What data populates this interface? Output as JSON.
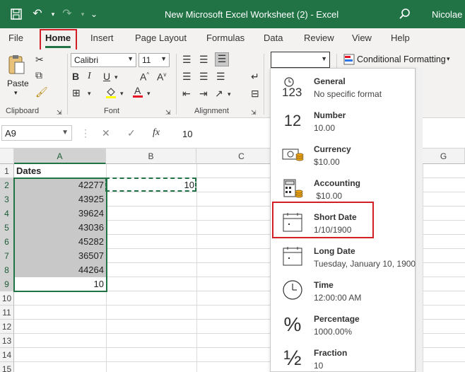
{
  "titlebar": {
    "title": "New Microsoft Excel Worksheet (2)  -  Excel",
    "user": "Nicolae",
    "color": "#217346"
  },
  "tabs": [
    "File",
    "Home",
    "Insert",
    "Page Layout",
    "Formulas",
    "Data",
    "Review",
    "View",
    "Help"
  ],
  "active_tab": "Home",
  "ribbon": {
    "paste_label": "Paste",
    "clipboard_label": "Clipboard",
    "font_name": "Calibri",
    "font_size": "11",
    "font_label": "Font",
    "alignment_label": "Alignment",
    "number_format_value": "",
    "conditional_formatting": "Conditional Formatting"
  },
  "formula_bar": {
    "name_box": "A9",
    "value": "10"
  },
  "columns": [
    "A",
    "B",
    "C",
    "G"
  ],
  "rows": [
    "1",
    "2",
    "3",
    "4",
    "5",
    "6",
    "7",
    "8",
    "9",
    "10",
    "11",
    "12",
    "13",
    "14",
    "15"
  ],
  "cells": {
    "A1": "Dates",
    "A2": "42277",
    "A3": "43925",
    "A4": "39624",
    "A5": "43036",
    "A6": "45282",
    "A7": "36507",
    "A8": "44264",
    "A9": "10",
    "B2": "10"
  },
  "number_formats": [
    {
      "name": "General",
      "example": "No specific format",
      "icon": "general-123-icon",
      "glyph": "123"
    },
    {
      "name": "Number",
      "example": "10.00",
      "icon": "number-12-icon",
      "glyph": "12"
    },
    {
      "name": "Currency",
      "example": "$10.00",
      "icon": "currency-icon",
      "glyph": ""
    },
    {
      "name": "Accounting",
      "example": " $10.00",
      "icon": "accounting-icon",
      "glyph": ""
    },
    {
      "name": "Short Date",
      "example": "1/10/1900",
      "icon": "calendar-icon",
      "glyph": ""
    },
    {
      "name": "Long Date",
      "example": "Tuesday, January 10, 1900",
      "icon": "calendar-icon",
      "glyph": ""
    },
    {
      "name": "Time",
      "example": "12:00:00 AM",
      "icon": "clock-icon",
      "glyph": ""
    },
    {
      "name": "Percentage",
      "example": "1000.00%",
      "icon": "percent-icon",
      "glyph": "%"
    },
    {
      "name": "Fraction",
      "example": "10",
      "icon": "fraction-icon",
      "glyph": "½"
    }
  ],
  "highlight_color": "#d21f26"
}
